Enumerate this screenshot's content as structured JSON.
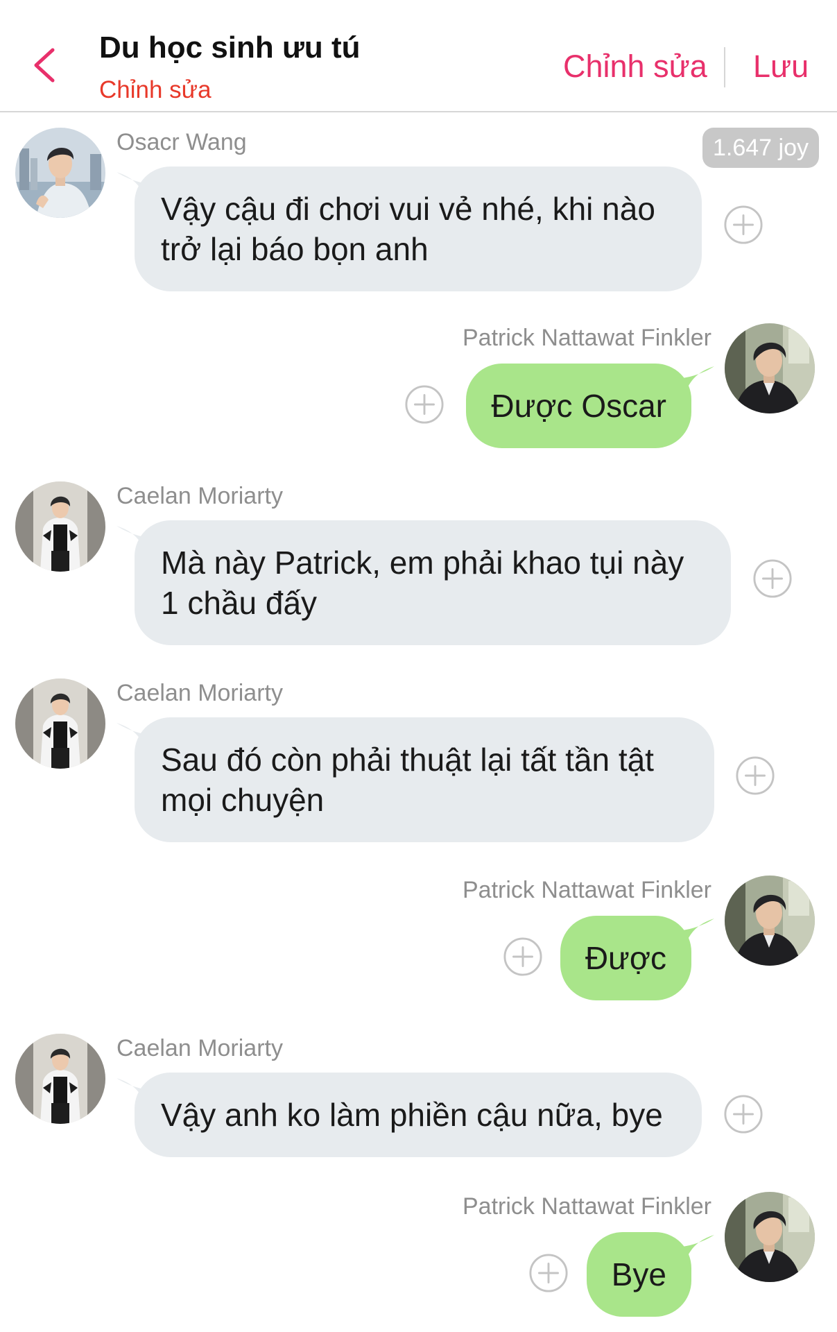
{
  "header": {
    "title": "Du học sinh ưu tú",
    "subtitle": "Chỉnh sửa",
    "edit_label": "Chỉnh sửa",
    "save_label": "Lưu",
    "accent_color": "#e8306b"
  },
  "badge": {
    "joy_label": "1.647 joy"
  },
  "messages": [
    {
      "sender": "Osacr Wang",
      "side": "incoming",
      "text": "Vậy cậu đi chơi vui vẻ nhé, khi nào trở lại báo bọn anh"
    },
    {
      "sender": "Patrick Nattawat Finkler",
      "side": "outgoing",
      "text": "Được Oscar"
    },
    {
      "sender": "Caelan Moriarty",
      "side": "incoming",
      "text": "Mà này Patrick, em phải khao tụi này 1 chầu đấy"
    },
    {
      "sender": "Caelan Moriarty",
      "side": "incoming",
      "text": "Sau đó còn phải thuật lại tất tần tật mọi chuyện"
    },
    {
      "sender": "Patrick Nattawat Finkler",
      "side": "outgoing",
      "text": "Được"
    },
    {
      "sender": "Caelan Moriarty",
      "side": "incoming",
      "text": "Vậy anh ko làm phiền cậu nữa, bye"
    },
    {
      "sender": "Patrick Nattawat Finkler",
      "side": "outgoing",
      "text": "Bye"
    }
  ],
  "colors": {
    "incoming_bubble": "#e7ebee",
    "outgoing_bubble": "#a9e58a",
    "sender_name": "#8e8e8e"
  },
  "icons": [
    "back-chevron-icon",
    "add-reaction-icon"
  ]
}
